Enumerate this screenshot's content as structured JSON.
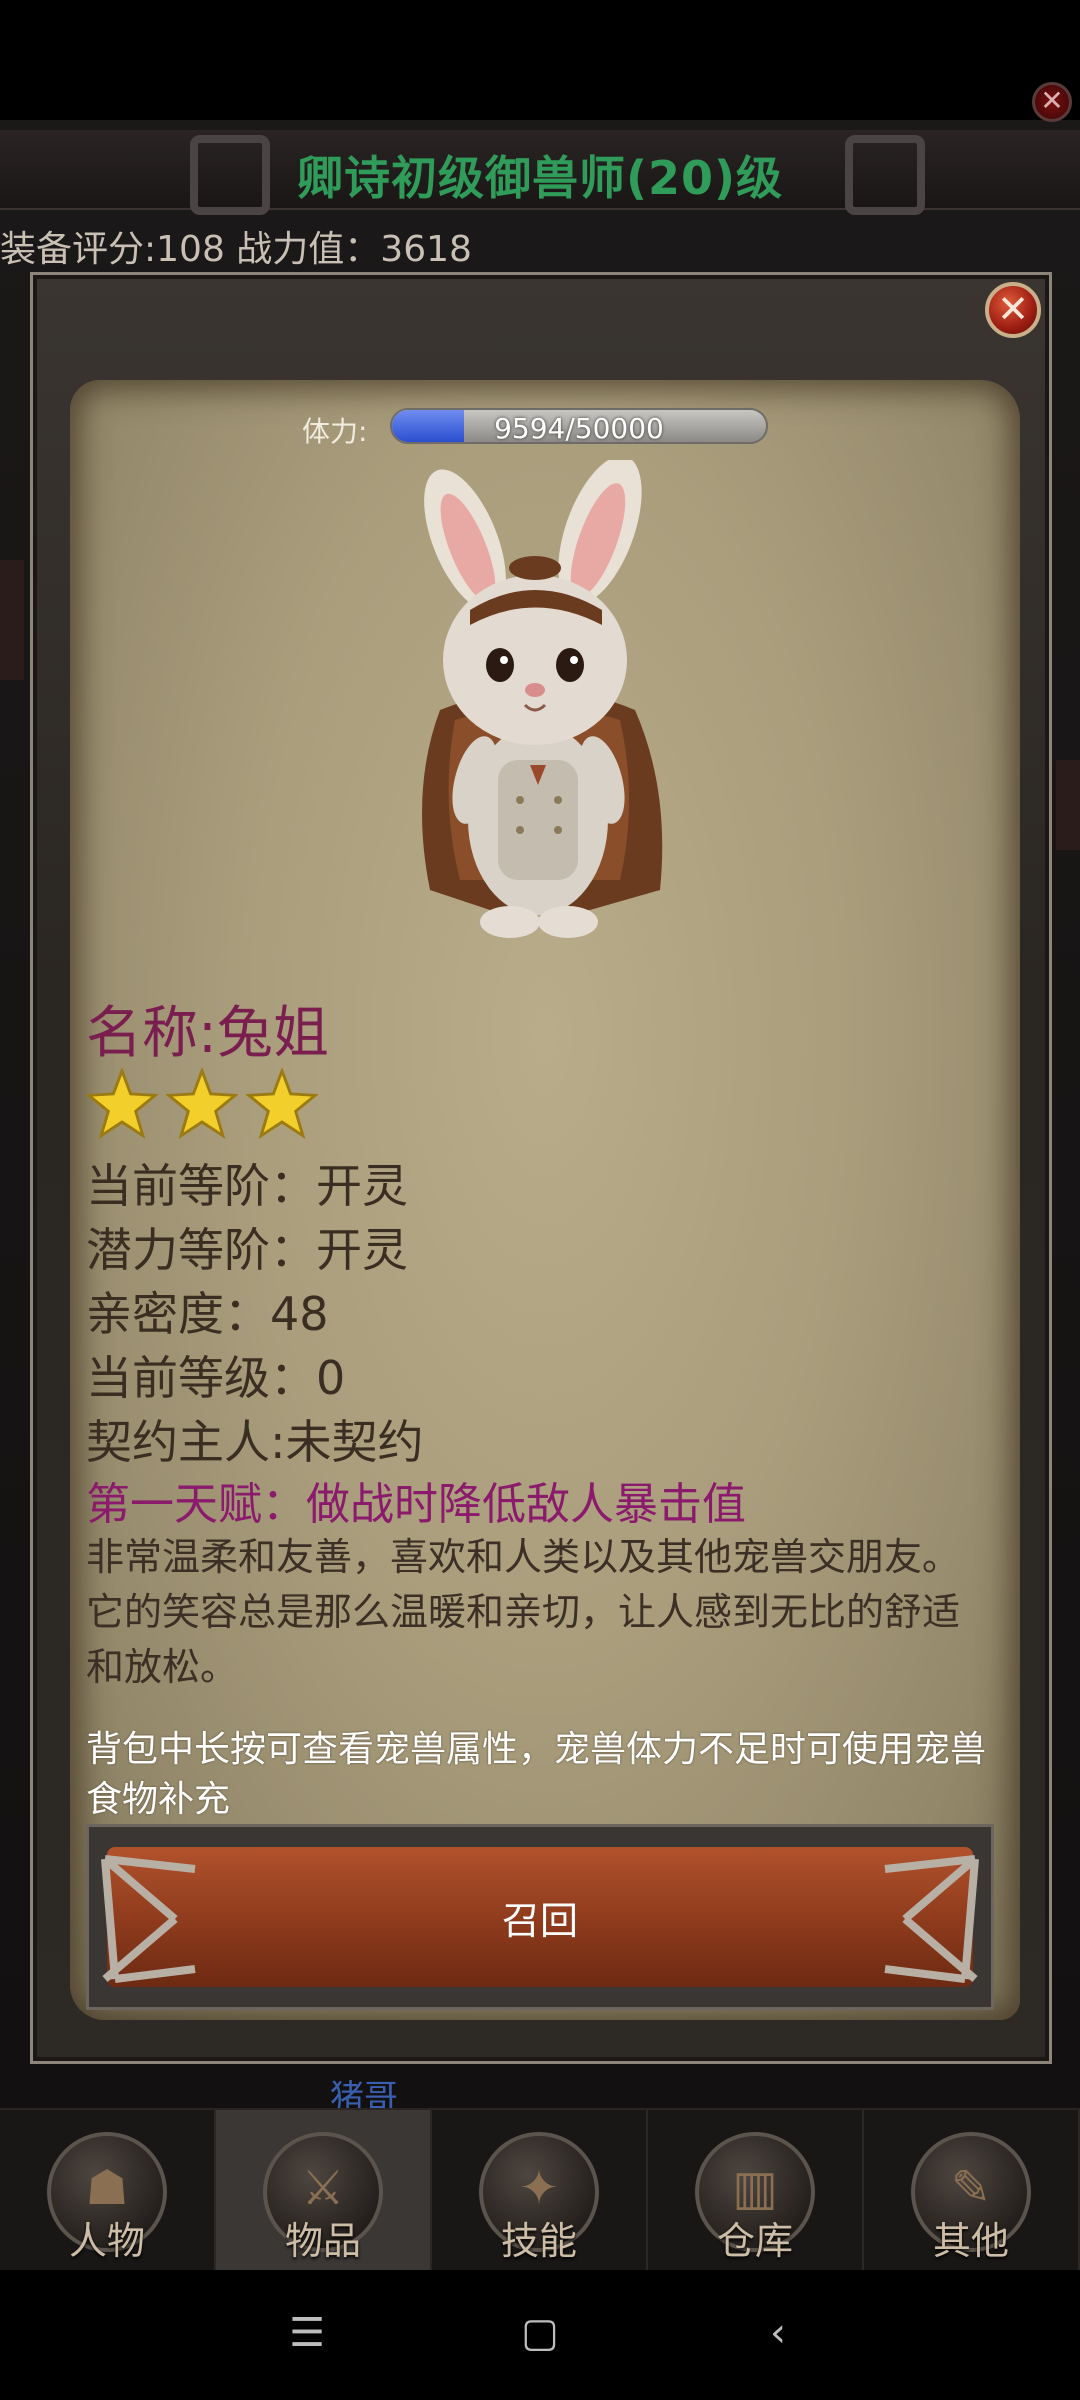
{
  "background": {
    "title": "卿诗初级御兽师(20)级",
    "score_text": "装备评分:108 战力值：3618",
    "peek_name": "猪哥",
    "colors": {
      "title": "#2f9c5a"
    }
  },
  "popup": {
    "stamina": {
      "label": "体力:",
      "current": 9594,
      "max": 50000,
      "text": "9594/50000"
    },
    "pet": {
      "name_line": "名称:兔姐",
      "stars": 3,
      "rank_line": "当前等阶：开灵",
      "potential_line": "潜力等阶：开灵",
      "intimacy_line": "亲密度：48",
      "level_line": "当前等级：0",
      "owner_line": "契约主人:未契约",
      "talent_line": "第一天赋：做战时降低敌人暴击值",
      "description": " 非常温柔和友善，喜欢和人类以及其他宠兽交朋友。它的笑容总是那么温暖和亲切，让人感到无比的舒适和放松。"
    },
    "hint": "背包中长按可查看宠兽属性，宠兽体力不足时可使用宠兽食物补充",
    "recall_label": "召回",
    "colors": {
      "name": "#7a1e50",
      "talent": "#8b1a6d",
      "recall": "#8d3a1c",
      "stamina_fill": "#2b4fd0"
    }
  },
  "tabs": [
    {
      "label": "人物",
      "icon": "character-icon",
      "active": false
    },
    {
      "label": "物品",
      "icon": "items-icon",
      "active": true
    },
    {
      "label": "技能",
      "icon": "skills-icon",
      "active": false
    },
    {
      "label": "仓库",
      "icon": "warehouse-icon",
      "active": false
    },
    {
      "label": "其他",
      "icon": "other-icon",
      "active": false
    }
  ],
  "system_nav": {
    "menu_glyph": "☰",
    "home_glyph": "▢",
    "back_glyph": "‹"
  }
}
